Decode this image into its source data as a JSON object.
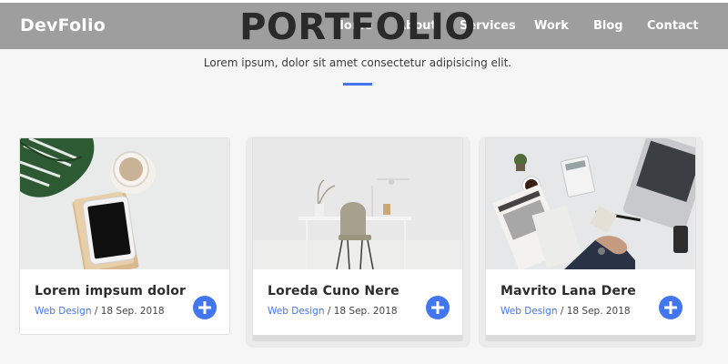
{
  "nav": {
    "brand": "DevFolio",
    "links": [
      "Home",
      "About",
      "Services",
      "Work",
      "Blog",
      "Contact"
    ]
  },
  "section": {
    "title": "PORTFOLIO",
    "subtitle": "Lorem ipsum, dolor sit amet consectetur adipisicing elit."
  },
  "cards": [
    {
      "title": "Lorem impsum dolor",
      "category": "Web Design",
      "date": "18 Sep. 2018"
    },
    {
      "title": "Loreda Cuno Nere",
      "category": "Web Design",
      "date": "18 Sep. 2018"
    },
    {
      "title": "Mavrito Lana Dere",
      "category": "Web Design",
      "date": "18 Sep. 2018"
    }
  ],
  "meta_separator": " / ",
  "colors": {
    "accent": "#4176ef",
    "navbar": "#9e9e9e",
    "background": "#f6f6f6"
  },
  "icons": {
    "card_action": "plus-circle-icon"
  }
}
